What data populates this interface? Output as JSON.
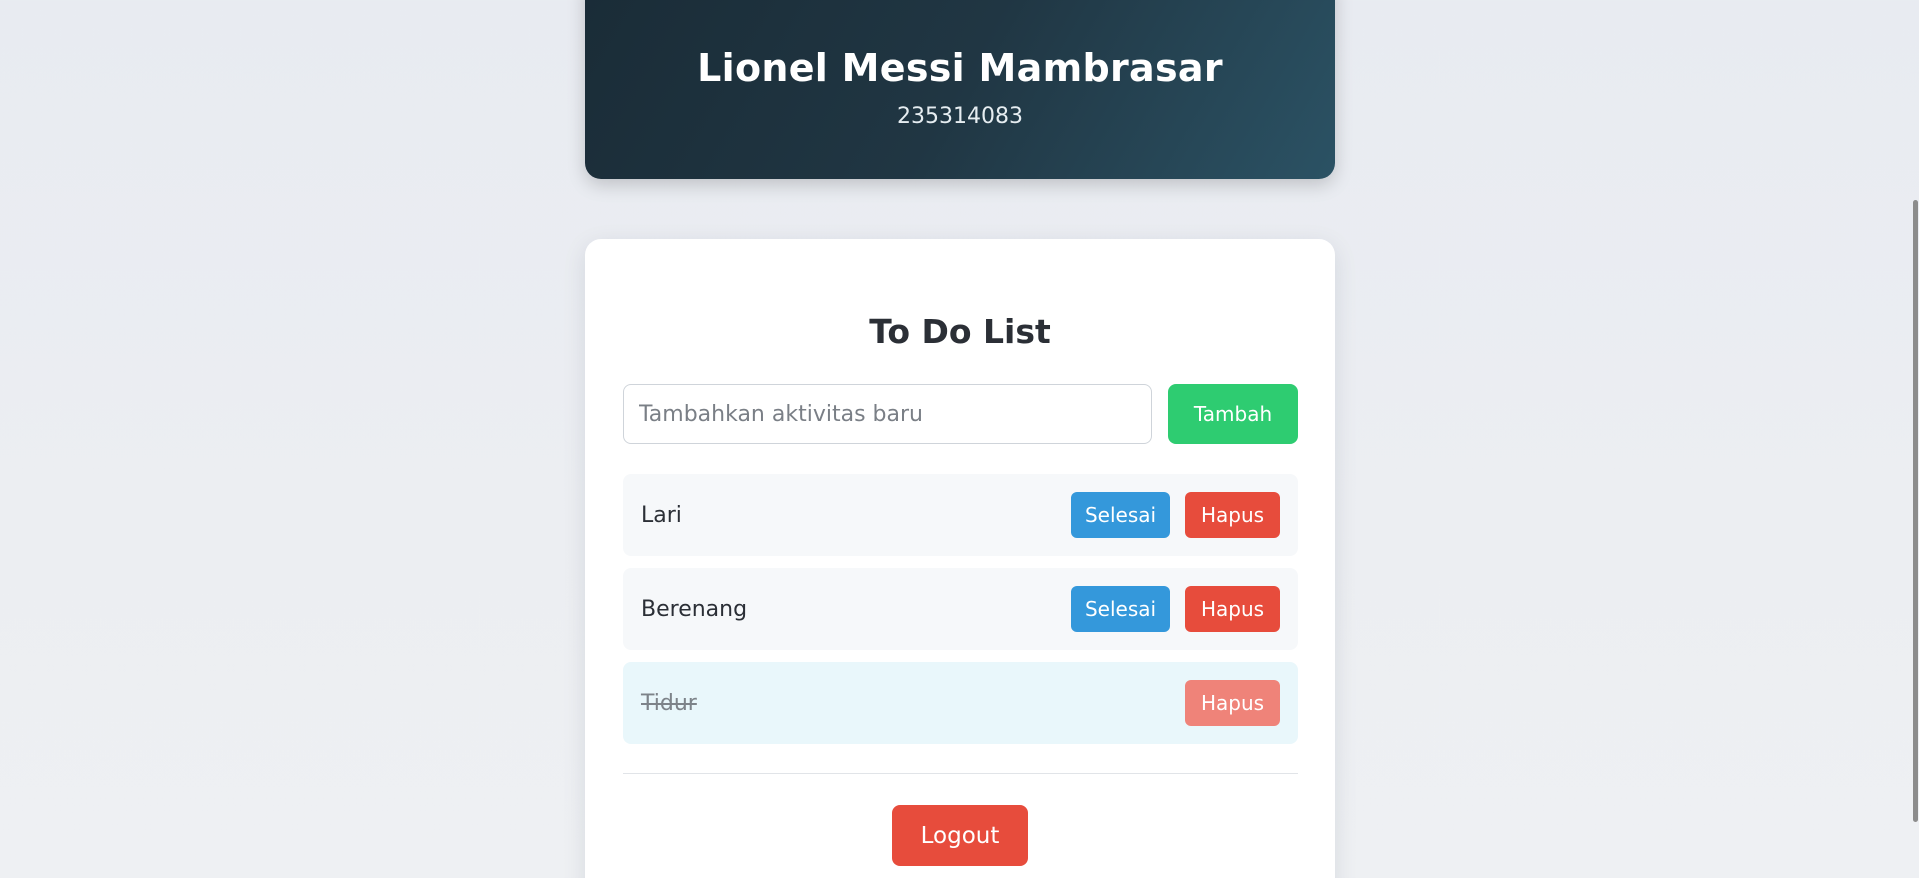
{
  "profile": {
    "name": "Lionel Messi Mambrasar",
    "id": "235314083"
  },
  "todo": {
    "title": "To Do List",
    "input_placeholder": "Tambahkan aktivitas baru",
    "input_value": "",
    "add_label": "Tambah",
    "tasks": [
      {
        "text": "Lari",
        "done": false,
        "done_label": "Selesai",
        "delete_label": "Hapus"
      },
      {
        "text": "Berenang",
        "done": false,
        "done_label": "Selesai",
        "delete_label": "Hapus"
      },
      {
        "text": "Tidur",
        "done": true,
        "delete_label": "Hapus"
      }
    ],
    "logout_label": "Logout"
  },
  "colors": {
    "add": "#2ecc71",
    "done": "#3498db",
    "delete": "#e74c3c",
    "profile_gradient_start": "#1a2c37",
    "profile_gradient_end": "#2b5264"
  }
}
